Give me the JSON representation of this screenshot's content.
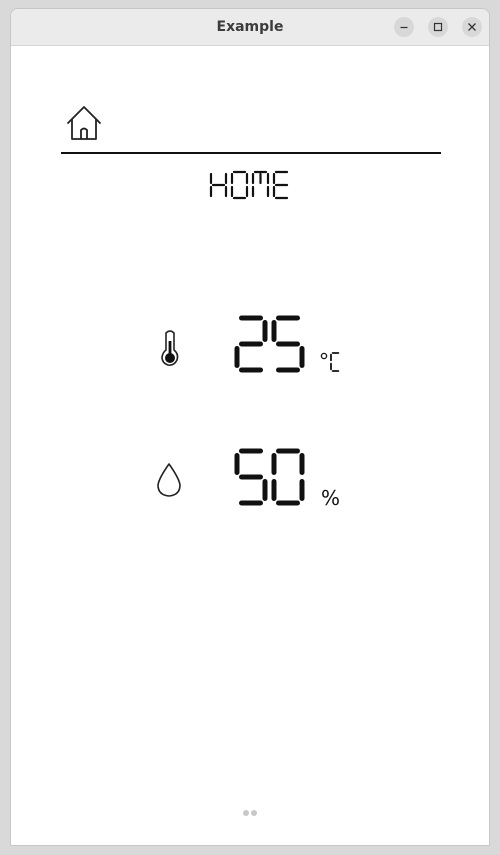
{
  "window": {
    "title": "Example"
  },
  "header": {
    "icon": "house-icon",
    "label": "HOME"
  },
  "sensors": [
    {
      "icon": "thermometer-icon",
      "value": "25",
      "unit": "°C"
    },
    {
      "icon": "water-drop-icon",
      "value": "50",
      "unit": "%"
    }
  ],
  "pager": {
    "pages": 2
  }
}
